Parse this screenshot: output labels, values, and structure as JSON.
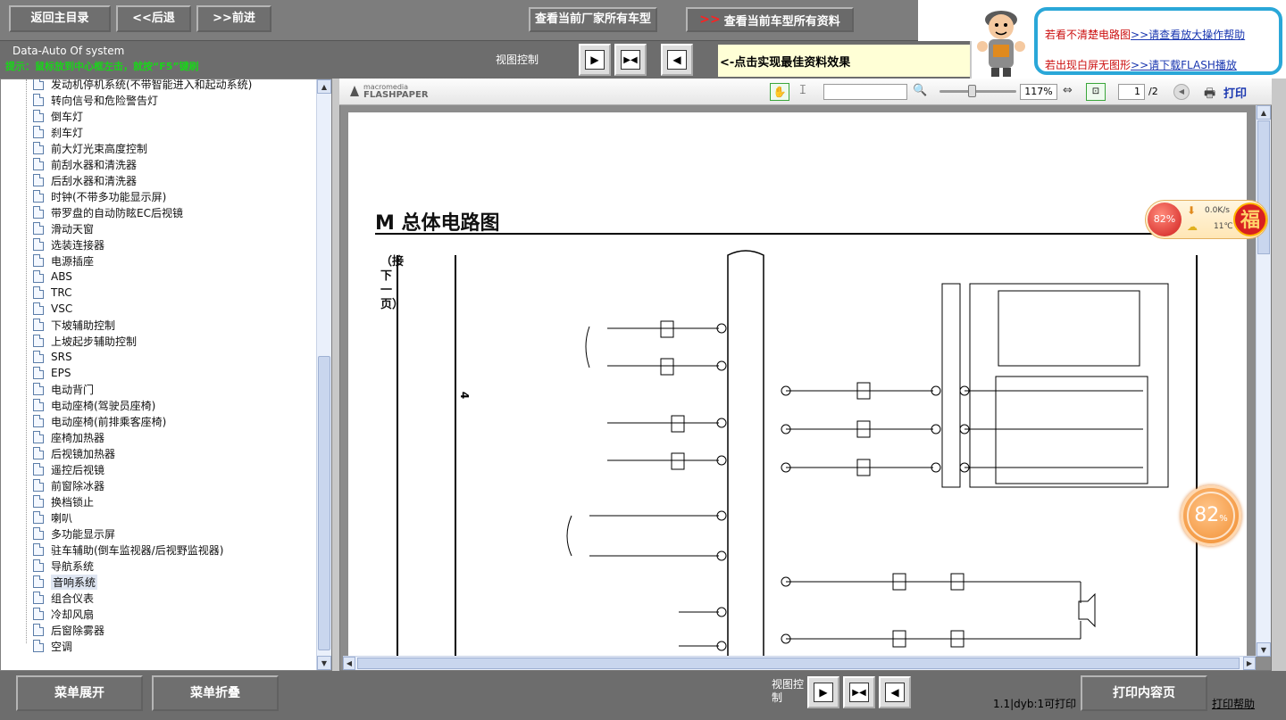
{
  "topnav": {
    "back_home": "返回主目录",
    "prev": "<<后退",
    "next": ">>前进",
    "view_models": "查看当前厂家所有车型",
    "view_all_data": "查看当前车型所有资料"
  },
  "status": {
    "app_name": "Data-Auto Of system",
    "tip": "提示：鼠标放到中心框左击，就按“F5”键刷",
    "view_control": "视图控制",
    "best_effect": "<-点击实现最佳资料效果"
  },
  "help": {
    "line1_text": "若看不清楚电路图",
    "line1_link": ">>请查看放大操作帮助",
    "line2_text": "若出现白屏无图形",
    "line2_link": ">>请下载FLASH播放"
  },
  "tree": {
    "items": [
      "发动机停机系统(不带智能进入和起动系统)",
      "转向信号和危险警告灯",
      "倒车灯",
      "刹车灯",
      "前大灯光束高度控制",
      "前刮水器和清洗器",
      "后刮水器和清洗器",
      "时钟(不带多功能显示屏)",
      "带罗盘的自动防眩EC后视镜",
      "滑动天窗",
      "选装连接器",
      "电源插座",
      "ABS",
      "TRC",
      "VSC",
      "下坡辅助控制",
      "上坡起步辅助控制",
      "SRS",
      "EPS",
      "电动背门",
      "电动座椅(驾驶员座椅)",
      "电动座椅(前排乘客座椅)",
      "座椅加热器",
      "后视镜加热器",
      "遥控后视镜",
      "前窗除冰器",
      "换档锁止",
      "喇叭",
      "多功能显示屏",
      "驻车辅助(倒车监视器/后视野监视器)",
      "导航系统",
      "音响系统",
      "组合仪表",
      "冷却风扇",
      "后窗除雾器",
      "空调"
    ],
    "selected_index": 31
  },
  "flashpaper": {
    "brand_small": "macromedia",
    "brand_big": "FLASHPAPER",
    "zoom": "117%",
    "page_current": "1",
    "page_total": "/2",
    "print_label": "打印"
  },
  "diagram": {
    "title": "M 总体电路图",
    "side_text": "（接下一页）",
    "marker_num": "4"
  },
  "widget": {
    "percent": "82%",
    "net": "0.0K/s",
    "temp": "11℃",
    "fu": "福",
    "ring_percent": "82"
  },
  "bottom": {
    "expand": "菜单展开",
    "collapse": "菜单折叠",
    "view_control": "视图控制",
    "status": "1.1|dyb:1可打印",
    "print_content": "打印内容页",
    "print_help": "打印帮助"
  }
}
